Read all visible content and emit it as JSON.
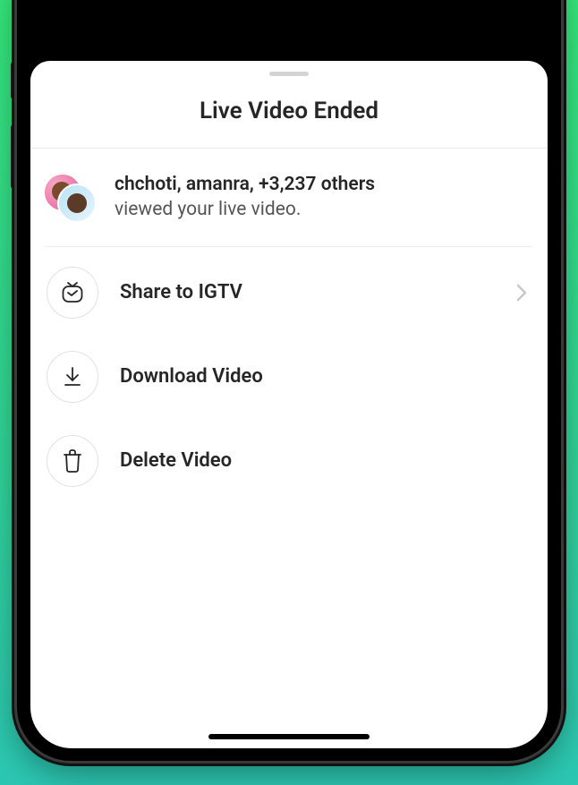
{
  "sheet": {
    "title": "Live Video Ended",
    "viewers": {
      "names": "chchoti, amanra, +3,237 others",
      "subtext": "viewed your live video."
    },
    "actions": {
      "share_igtv": "Share to IGTV",
      "download": "Download Video",
      "delete": "Delete Video"
    }
  }
}
